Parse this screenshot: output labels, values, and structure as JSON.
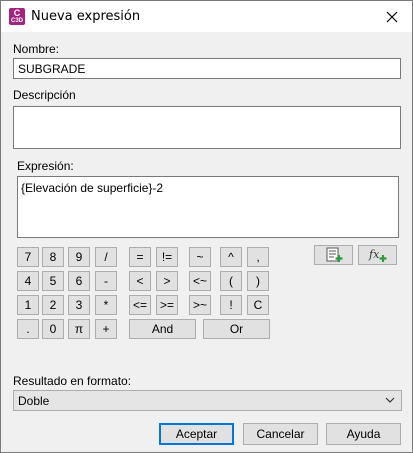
{
  "window": {
    "title": "Nueva expresión",
    "icon_text": "C",
    "icon_subtext": "C3D"
  },
  "name": {
    "label": "Nombre:",
    "value": "SUBGRADE"
  },
  "description": {
    "label": "Descripción",
    "value": ""
  },
  "expression": {
    "label": "Expresión:",
    "value": "{Elevación de superficie}-2"
  },
  "keypad": {
    "row1": [
      "7",
      "8",
      "9",
      "/",
      "=",
      "!=",
      "~",
      "^",
      ","
    ],
    "row2": [
      "4",
      "5",
      "6",
      "-",
      "<",
      ">",
      "<~",
      "(",
      ")"
    ],
    "row3": [
      "1",
      "2",
      "3",
      "*",
      "<=",
      ">=",
      ">~",
      "!",
      "C"
    ],
    "row4": [
      ".",
      "0",
      "π",
      "+",
      "And",
      "Or"
    ]
  },
  "tool_icons": [
    "insert-property-icon",
    "insert-function-icon"
  ],
  "format": {
    "label": "Resultado en formato:",
    "value": "Doble"
  },
  "buttons": {
    "accept": "Aceptar",
    "cancel": "Cancelar",
    "help": "Ayuda"
  },
  "colors": {
    "app_icon": "#a3237f",
    "default_border": "#0078d7"
  }
}
